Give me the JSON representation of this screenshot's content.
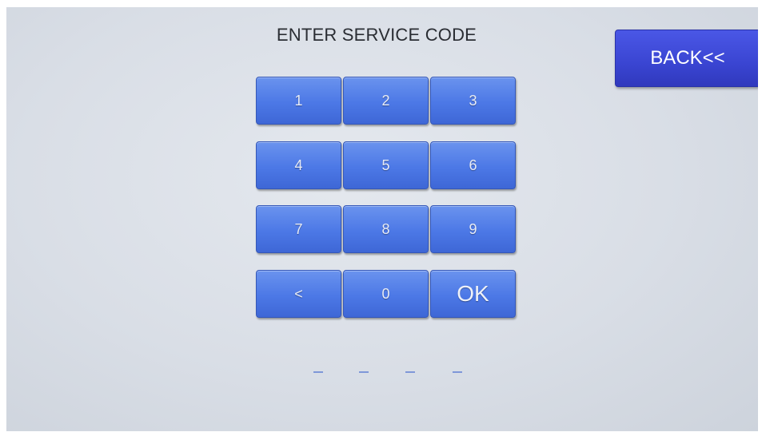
{
  "title": "ENTER SERVICE CODE",
  "back_label": "BACK<<",
  "keypad": {
    "rows": [
      [
        "1",
        "2",
        "3"
      ],
      [
        "4",
        "5",
        "6"
      ],
      [
        "7",
        "8",
        "9"
      ],
      [
        "<",
        "0",
        "OK"
      ]
    ]
  },
  "code_slots": [
    "_",
    "_",
    "_",
    "_"
  ],
  "colors": {
    "key": "#4c78e6",
    "back_button": "#3a45d2",
    "background": "#d9dee6",
    "slot_dash": "#7f97d8"
  }
}
